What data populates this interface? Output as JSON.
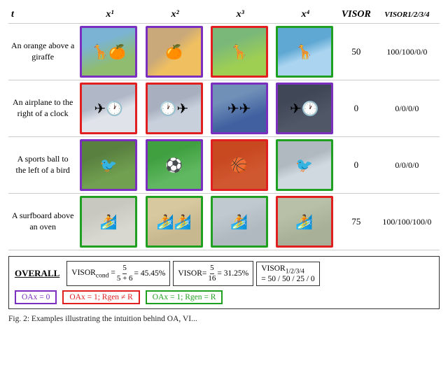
{
  "header": {
    "col_t": "t",
    "col_x1": "x¹",
    "col_x2": "x²",
    "col_x3": "x³",
    "col_x4": "x⁴",
    "col_visor": "VISOR",
    "col_visor_sub": "VISOR1/2/3/4"
  },
  "rows": [
    {
      "label": "An orange above a giraffe",
      "visor": "50",
      "visor_sub": "100/100/0/0",
      "cells": [
        {
          "border": "purple",
          "bg": "giraffe-orange"
        },
        {
          "border": "purple",
          "bg": "orange-close"
        },
        {
          "border": "red",
          "bg": "giraffe-grass"
        },
        {
          "border": "green",
          "bg": "giraffe-sky"
        }
      ]
    },
    {
      "label": "An airplane to the right of a clock",
      "visor": "0",
      "visor_sub": "0/0/0/0",
      "cells": [
        {
          "border": "red",
          "bg": "plane-clock"
        },
        {
          "border": "red",
          "bg": "clock-plane"
        },
        {
          "border": "purple",
          "bg": "planes"
        },
        {
          "border": "purple",
          "bg": "clock-dark"
        }
      ]
    },
    {
      "label": "A sports ball to the left of a bird",
      "visor": "0",
      "visor_sub": "0/0/0/0",
      "cells": [
        {
          "border": "purple",
          "bg": "bird-grass"
        },
        {
          "border": "purple",
          "bg": "ball-grass"
        },
        {
          "border": "red",
          "bg": "basketball"
        },
        {
          "border": "green",
          "bg": "crow"
        }
      ]
    },
    {
      "label": "A surfboard above an oven",
      "visor": "75",
      "visor_sub": "100/100/100/0",
      "cells": [
        {
          "border": "green",
          "bg": "surfboard-oven"
        },
        {
          "border": "green",
          "bg": "surfboards"
        },
        {
          "border": "green",
          "bg": "surfboard-tall"
        },
        {
          "border": "red",
          "bg": "surfboard-oven2"
        }
      ]
    }
  ],
  "overall": {
    "label": "OVERALL",
    "visor_cond_num": "5",
    "visor_cond_den": "5 + 6",
    "visor_cond_pct": "= 45.45%",
    "visor_num": "5",
    "visor_den": "16",
    "visor_pct": "= 31.25%",
    "visor_sub_val": "= 50 / 50 / 25 / 0",
    "visor_sub_label": "VISOR1/2/3/4"
  },
  "legend": {
    "item1": "OAx = 0",
    "item2": "OAx = 1; Rgen ≠ R",
    "item3": "OAx = 1; Rgen = R"
  },
  "caption": "Fig. 2: Examples illustrating the intuition behind OA, VI..."
}
